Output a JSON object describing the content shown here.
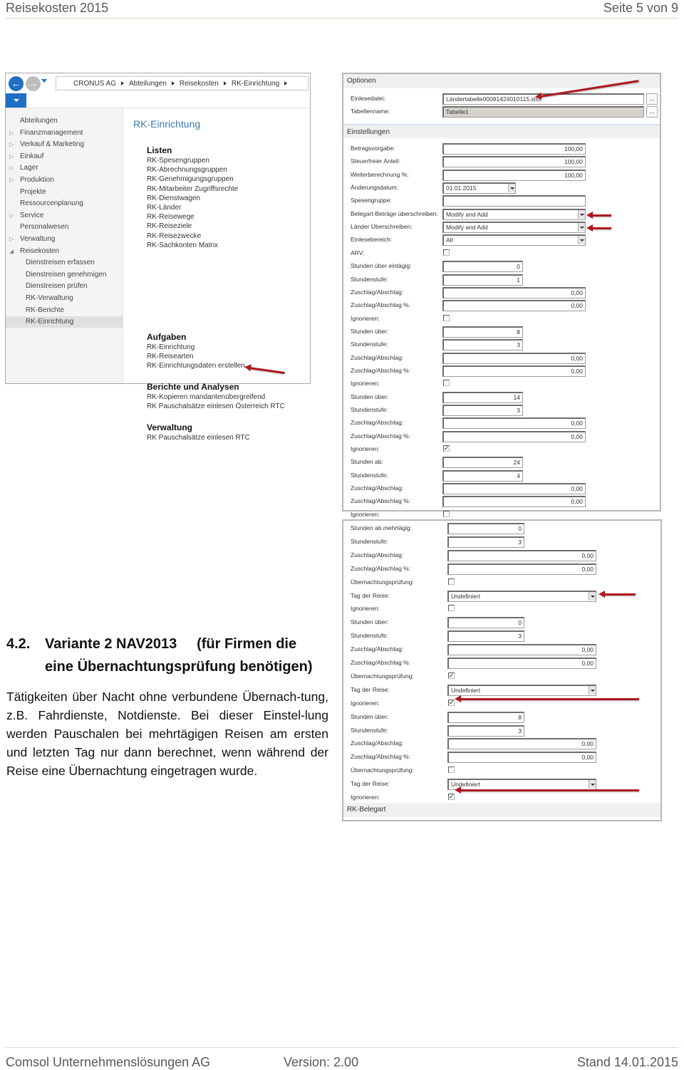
{
  "page_header": {
    "left": "Reisekosten 2015",
    "right": "Seite 5 von 9"
  },
  "page_footer": {
    "company": "Comsol Unternehmenslösungen AG",
    "version": "Version: 2.00",
    "date": "Stand 14.01.2015"
  },
  "nav_window": {
    "breadcrumb": [
      "CRONUS AG",
      "Abteilungen",
      "Reisekosten",
      "RK-Einrichtung"
    ],
    "icons": {
      "back": "arrow-left-icon",
      "forward": "arrow-right-icon",
      "history": "chevron-down-icon"
    },
    "nav_items": [
      {
        "label": "Abteilungen",
        "expander": ""
      },
      {
        "label": "Finanzmanagement",
        "expander": "▷"
      },
      {
        "label": "Verkauf & Marketing",
        "expander": "▷"
      },
      {
        "label": "Einkauf",
        "expander": "▷"
      },
      {
        "label": "Lager",
        "expander": "▷"
      },
      {
        "label": "Produktion",
        "expander": "▷"
      },
      {
        "label": "Projekte",
        "expander": ""
      },
      {
        "label": "Ressourcenplanung",
        "expander": ""
      },
      {
        "label": "Service",
        "expander": "▷"
      },
      {
        "label": "Personalwesen",
        "expander": ""
      },
      {
        "label": "Verwaltung",
        "expander": "▷"
      },
      {
        "label": "Reisekosten",
        "expander": "◢"
      }
    ],
    "sub_items": [
      "Dienstreisen erfassen",
      "Dienstreisen genehmigen",
      "Dienstreisen prüfen",
      "RK-Verwaltung",
      "RK-Berichte",
      "RK-Einrichtung"
    ],
    "content_title": "RK-Einrichtung",
    "groups": [
      {
        "title": "Listen",
        "links": [
          "RK-Spesengruppen",
          "RK-Abrechnungsgruppen",
          "RK-Genehmigungsgruppen",
          "RK-Mitarbeiter Zugriffsrechte",
          "RK-Dienstwagen",
          "RK-Länder",
          "RK-Reisewege",
          "RK-Reiseziele",
          "RK-Reisezwecke",
          "RK-Sachkonten Matrix"
        ]
      },
      {
        "title": "Aufgaben",
        "links": [
          "RK-Einrichtung",
          "RK-Reisearten",
          "RK-Einrichtungsdaten erstellen"
        ]
      },
      {
        "title": "Berichte und Analysen",
        "links": [
          "RK-Kopieren mandantenübergreifend",
          "RK Pauschalsätze einlesen Österreich RTC"
        ]
      },
      {
        "title": "Verwaltung",
        "links": [
          "RK Pauschalsätze einlesen RTC"
        ]
      }
    ]
  },
  "options_panel": {
    "section_optionen": "Optionen",
    "einlesedatei": {
      "label": "Einlesedatei:",
      "value": "Ländertabelle00081424010115.xlsx",
      "button": "..."
    },
    "tabellenname": {
      "label": "Tabellenname:",
      "value": "Tabelle1",
      "button": "..."
    },
    "section_einstellungen": "Einstellungen",
    "fields": [
      {
        "label": "Betragsvorgabe:",
        "type": "num",
        "value": "100,00"
      },
      {
        "label": "Steuerfreier Anteil:",
        "type": "num",
        "value": "100,00"
      },
      {
        "label": "Weiterberechnung %:",
        "type": "num",
        "value": "100,00"
      },
      {
        "label": "Änderungsdatum:",
        "type": "date",
        "value": "01.01.2015"
      },
      {
        "label": "Spesengruppe:",
        "type": "text",
        "value": ""
      },
      {
        "label": "Belegart-Beträge überschreiben:",
        "type": "select",
        "value": "Modify and Add"
      },
      {
        "label": "Länder Überschreiben:",
        "type": "select",
        "value": "Modify and Add"
      },
      {
        "label": "Einlesebereich:",
        "type": "select",
        "value": "All"
      },
      {
        "label": "ARV:",
        "type": "check",
        "checked": false
      },
      {
        "label": "Stunden über eintägig:",
        "type": "short",
        "value": "0"
      },
      {
        "label": "Stundenstufe:",
        "type": "short",
        "value": "1"
      },
      {
        "label": "Zuschlag/Abschlag:",
        "type": "num",
        "value": "0,00"
      },
      {
        "label": "Zuschlag/Abschlag %:",
        "type": "num",
        "value": "0,00"
      },
      {
        "label": "Ignorieren:",
        "type": "check",
        "checked": false
      },
      {
        "label": "Stunden über:",
        "type": "short",
        "value": "8"
      },
      {
        "label": "Stundenstufe:",
        "type": "short",
        "value": "3"
      },
      {
        "label": "Zuschlag/Abschlag:",
        "type": "num",
        "value": "0,00"
      },
      {
        "label": "Zuschlag/Abschlag %:",
        "type": "num",
        "value": "0,00"
      },
      {
        "label": "Ignorieren:",
        "type": "check",
        "checked": false
      },
      {
        "label": "Stunden über:",
        "type": "short",
        "value": "14"
      },
      {
        "label": "Stundenstufe:",
        "type": "short",
        "value": "3"
      },
      {
        "label": "Zuschlag/Abschlag:",
        "type": "num",
        "value": "0,00"
      },
      {
        "label": "Zuschlag/Abschlag %:",
        "type": "num",
        "value": "0,00"
      },
      {
        "label": "Ignorieren:",
        "type": "check",
        "checked": true
      },
      {
        "label": "Stunden ab:",
        "type": "short",
        "value": "24"
      },
      {
        "label": "Stundenstufe:",
        "type": "short",
        "value": "4"
      },
      {
        "label": "Zuschlag/Abschlag:",
        "type": "num",
        "value": "0,00"
      },
      {
        "label": "Zuschlag/Abschlag %:",
        "type": "num",
        "value": "0,00"
      },
      {
        "label": "Ignorieren:",
        "type": "check",
        "checked": false
      }
    ]
  },
  "multiday_panel": {
    "fields": [
      {
        "label": "Stunden ab mehrtägig:",
        "type": "short",
        "value": "0"
      },
      {
        "label": "Stundenstufe:",
        "type": "short",
        "value": "3"
      },
      {
        "label": "Zuschlag/Abschlag:",
        "type": "num",
        "value": "0,00"
      },
      {
        "label": "Zuschlag/Abschlag %:",
        "type": "num",
        "value": "0,00"
      },
      {
        "label": "Übernachtungsprüfung:",
        "type": "check",
        "checked": false
      },
      {
        "label": "Tag der Reise:",
        "type": "select",
        "value": "Undefiniert"
      },
      {
        "label": "Ignorieren:",
        "type": "check",
        "checked": false
      },
      {
        "label": "Stunden über:",
        "type": "short",
        "value": "0"
      },
      {
        "label": "Stundenstufe:",
        "type": "short",
        "value": "3"
      },
      {
        "label": "Zuschlag/Abschlag:",
        "type": "num",
        "value": "0,00"
      },
      {
        "label": "Zuschlag/Abschlag %:",
        "type": "num",
        "value": "0,00"
      },
      {
        "label": "Übernachtungsprüfung:",
        "type": "check",
        "checked": true
      },
      {
        "label": "Tag der Reise:",
        "type": "select",
        "value": "Undefiniert"
      },
      {
        "label": "Ignorieren:",
        "type": "check",
        "checked": true
      },
      {
        "label": "Stunden über:",
        "type": "short",
        "value": "8"
      },
      {
        "label": "Stundenstufe:",
        "type": "short",
        "value": "3"
      },
      {
        "label": "Zuschlag/Abschlag:",
        "type": "num",
        "value": "0,00"
      },
      {
        "label": "Zuschlag/Abschlag %:",
        "type": "num",
        "value": "0,00"
      },
      {
        "label": "Übernachtungsprüfung:",
        "type": "check",
        "checked": false
      },
      {
        "label": "Tag der Reise:",
        "type": "select",
        "value": "Undefiniert"
      },
      {
        "label": "Ignorieren:",
        "type": "check",
        "checked": true
      }
    ],
    "section_footer": "RK-Belegart"
  },
  "section": {
    "number": "4.2.",
    "title_line1": "Variante 2 NAV2013     (für Firmen die",
    "title_line2": "eine Übernachtungsprüfung benötigen)",
    "body": "Tätigkeiten über Nacht ohne verbundene Übernach-tung, z.B. Fahrdienste, Notdienste. Bei dieser Einstel-lung werden Pauschalen bei mehrtägigen Reisen am ersten und letzten Tag nur dann berechnet, wenn während der Reise eine Übernachtung eingetragen wurde."
  },
  "colors": {
    "accent_blue": "#1f6fc5",
    "title_blue": "#3a7ab0",
    "annotation_red": "#b0171f"
  }
}
